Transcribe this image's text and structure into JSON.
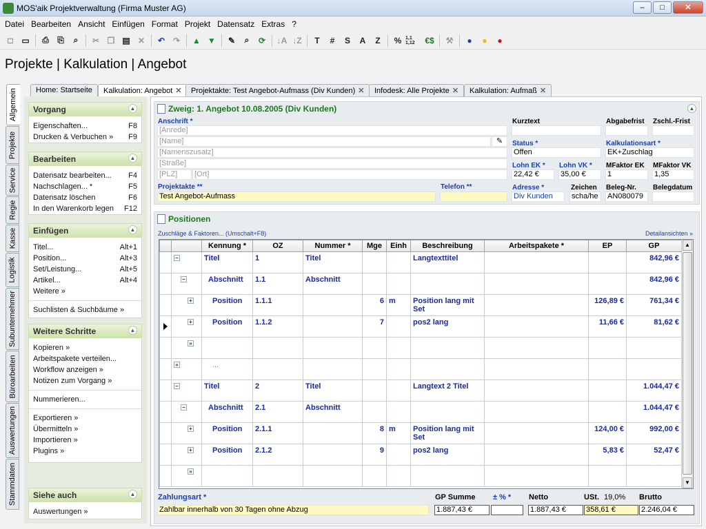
{
  "window": {
    "title": "MOS'aik Projektverwaltung (Firma Muster AG)"
  },
  "menu": [
    "Datei",
    "Bearbeiten",
    "Ansicht",
    "Einfügen",
    "Format",
    "Projekt",
    "Datensatz",
    "Extras",
    "?"
  ],
  "toolbar": {
    "text_buttons": [
      "T",
      "#",
      "S",
      "A",
      "Z",
      "%",
      "1,1 1,12",
      "€$"
    ]
  },
  "page_title": "Projekte | Kalkulation | Angebot",
  "vertical_tabs": [
    "Allgemein",
    "Projekte",
    "Service",
    "Regie",
    "Kasse",
    "Logistik",
    "Subunternehmer",
    "Büroarbeiten",
    "Auswertungen",
    "Stammdaten"
  ],
  "doc_tabs": [
    {
      "label": "Home: Startseite",
      "closable": false
    },
    {
      "label": "Kalkulation: Angebot",
      "closable": true
    },
    {
      "label": "Projektakte: Test Angebot-Aufmass (Div Kunden)",
      "closable": true
    },
    {
      "label": "Infodesk: Alle Projekte",
      "closable": true
    },
    {
      "label": "Kalkulation: Aufmaß",
      "closable": true
    }
  ],
  "sidebar": {
    "vorgang": {
      "title": "Vorgang",
      "items": [
        {
          "label": "Eigenschaften...",
          "key": "F8"
        },
        {
          "label": "Drucken & Verbuchen »",
          "key": "F9"
        }
      ]
    },
    "bearbeiten": {
      "title": "Bearbeiten",
      "items": [
        {
          "label": "Datensatz bearbeiten...",
          "key": "F4"
        },
        {
          "label": "Nachschlagen... *",
          "key": "F5"
        },
        {
          "label": "Datensatz löschen",
          "key": "F6"
        },
        {
          "label": "In den Warenkorb legen",
          "key": "F12"
        }
      ]
    },
    "einfuegen": {
      "title": "Einfügen",
      "items": [
        {
          "label": "Titel...",
          "key": "Alt+1"
        },
        {
          "label": "Position...",
          "key": "Alt+3"
        },
        {
          "label": "Set/Leistung...",
          "key": "Alt+5"
        },
        {
          "label": "Artikel...",
          "key": "Alt+4"
        },
        {
          "label": "Weitere »",
          "key": ""
        },
        {
          "label": "Suchlisten & Suchbäume »",
          "key": ""
        }
      ]
    },
    "weitere": {
      "title": "Weitere Schritte",
      "items": [
        {
          "label": "Kopieren »"
        },
        {
          "label": "Arbeitspakete verteilen..."
        },
        {
          "label": "Workflow anzeigen »"
        },
        {
          "label": "Notizen zum Vorgang »"
        },
        {
          "label": "Nummerieren..."
        },
        {
          "label": "Exportieren »"
        },
        {
          "label": "Übermitteln »"
        },
        {
          "label": "Importieren »"
        },
        {
          "label": "Plugins »"
        }
      ]
    },
    "siehe": {
      "title": "Siehe auch",
      "items": [
        {
          "label": "Auswertungen »"
        }
      ]
    }
  },
  "header_section": {
    "title": "Zweig: 1. Angebot 10.08.2005 (Div Kunden)",
    "anschrift_label": "Anschrift *",
    "anrede": "[Anrede]",
    "name": "[Name]",
    "namenszusatz": "[Namenszusatz]",
    "strasse": "[Straße]",
    "plz": "[PLZ]",
    "ort": "[Ort]",
    "projektakte_label": "Projektakte **",
    "projektakte": "Test Angebot-Aufmass",
    "telefon_label": "Telefon **",
    "telefon": "",
    "kurztext_label": "Kurztext",
    "abgabefrist_label": "Abgabefrist",
    "zschl_label": "Zschl.-Frist",
    "status_label": "Status *",
    "status": "Offen",
    "kalkart_label": "Kalkulationsart *",
    "kalkart": "EK+Zuschlag",
    "lohnek_label": "Lohn EK *",
    "lohnek": "22,42 €",
    "lohnvk_label": "Lohn VK *",
    "lohnvk": "35,00 €",
    "mfaktorek_label": "MFaktor EK",
    "mfaktorek": "1",
    "mfaktorvk_label": "MFaktor VK",
    "mfaktorvk": "1,35",
    "adresse_label": "Adresse *",
    "adresse": "Div Kunden",
    "zeichen_label": "Zeichen",
    "zeichen": "scha/he",
    "belegnr_label": "Beleg-Nr.",
    "belegnr": "AN080079",
    "belegdatum_label": "Belegdatum",
    "belegdatum": ""
  },
  "positions_section": {
    "title": "Positionen",
    "zuschlaege_link": "Zuschläge & Faktoren... (Umschalt+F8)",
    "details_link": "Detailansichten »",
    "columns": [
      "Kennung *",
      "OZ",
      "Nummer *",
      "Mge",
      "Einh",
      "Beschreibung",
      "Arbeitspakete *",
      "EP",
      "GP"
    ],
    "rows": [
      {
        "kennung": "Titel",
        "oz": "1",
        "nummer": "Titel",
        "mge": "",
        "einh": "",
        "beschreibung": "Langtexttitel",
        "ap": "",
        "ep": "",
        "gp": "842,96 €"
      },
      {
        "kennung": "Abschnitt",
        "oz": "1.1",
        "nummer": "Abschnitt",
        "mge": "",
        "einh": "",
        "beschreibung": "",
        "ap": "",
        "ep": "",
        "gp": "842,96 €"
      },
      {
        "kennung": "Position",
        "oz": "1.1.1",
        "nummer": "",
        "mge": "6",
        "einh": "m",
        "beschreibung": "Position lang mit Set",
        "ap": "",
        "ep": "126,89 €",
        "gp": "761,34 €"
      },
      {
        "kennung": "Position",
        "oz": "1.1.2",
        "nummer": "",
        "mge": "7",
        "einh": "",
        "beschreibung": "pos2 lang",
        "ap": "",
        "ep": "11,66 €",
        "gp": "81,62 €"
      },
      {
        "kennung": "",
        "oz": "",
        "nummer": "",
        "mge": "",
        "einh": "",
        "beschreibung": "",
        "ap": "",
        "ep": "",
        "gp": ""
      },
      {
        "kennung": "...",
        "oz": "",
        "nummer": "",
        "mge": "",
        "einh": "",
        "beschreibung": "",
        "ap": "",
        "ep": "",
        "gp": ""
      },
      {
        "kennung": "Titel",
        "oz": "2",
        "nummer": "Titel",
        "mge": "",
        "einh": "",
        "beschreibung": "Langtext 2 Titel",
        "ap": "",
        "ep": "",
        "gp": "1.044,47 €"
      },
      {
        "kennung": "Abschnitt",
        "oz": "2.1",
        "nummer": "Abschnitt",
        "mge": "",
        "einh": "",
        "beschreibung": "",
        "ap": "",
        "ep": "",
        "gp": "1.044,47 €"
      },
      {
        "kennung": "Position",
        "oz": "2.1.1",
        "nummer": "",
        "mge": "8",
        "einh": "m",
        "beschreibung": "Position lang mit Set",
        "ap": "",
        "ep": "124,00 €",
        "gp": "992,00 €"
      },
      {
        "kennung": "Position",
        "oz": "2.1.2",
        "nummer": "",
        "mge": "9",
        "einh": "",
        "beschreibung": "pos2 lang",
        "ap": "",
        "ep": "5,83 €",
        "gp": "52,47 €"
      },
      {
        "kennung": "",
        "oz": "",
        "nummer": "",
        "mge": "",
        "einh": "",
        "beschreibung": "",
        "ap": "",
        "ep": "",
        "gp": ""
      }
    ]
  },
  "footer": {
    "zahlungsart_label": "Zahlungsart *",
    "zahlungsart": "Zahlbar innerhalb von 30 Tagen ohne Abzug",
    "gpsumme_label": "GP Summe",
    "gpsumme": "1.887,43 €",
    "pct_label": "± % *",
    "pct": "",
    "netto_label": "Netto",
    "netto": "1.887,43 €",
    "ust_label": "USt.",
    "ust_rate": "19,0%",
    "ust": "358,61 €",
    "brutto_label": "Brutto",
    "brutto": "2.246,04 €"
  }
}
